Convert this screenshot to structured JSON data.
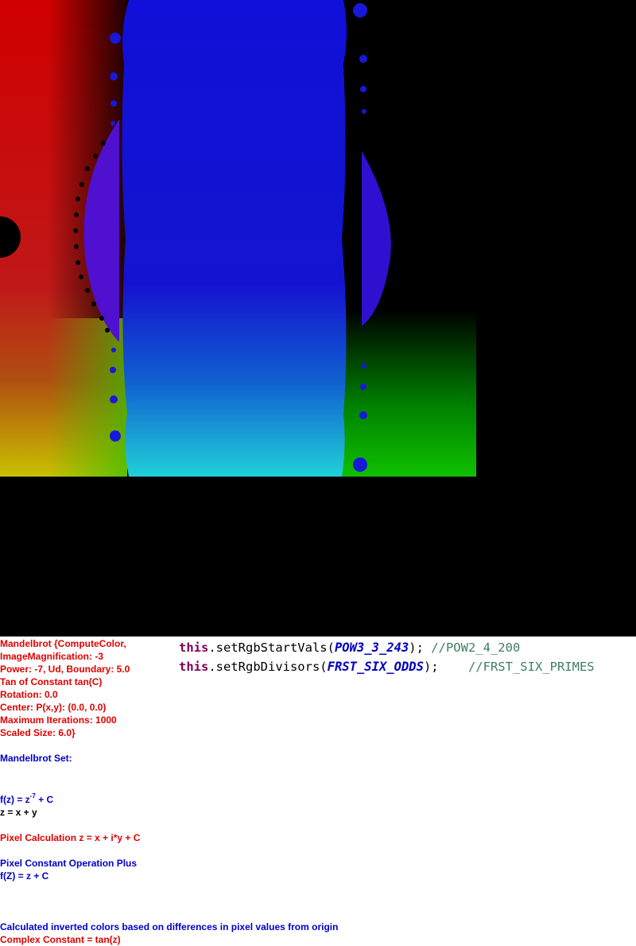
{
  "info": {
    "line1": "Mandelbrot {ComputeColor,",
    "line2": "ImageMagnification: -3",
    "line3": "Power: -7, Ud, Boundary: 5.0",
    "line4": "Tan of Constant tan(C)",
    "line5": "Rotation: 0.0",
    "line6": "Center: P(x,y): (0.0, 0.0)",
    "line7": "Maximum Iterations: 1000",
    "line8": "Scaled Size: 6.0}",
    "set_title": "Mandelbrot Set:",
    "fz_prefix": "f(z) = z",
    "fz_exp": "-7",
    "fz_suffix": " + C",
    "z_def": "z = x + y",
    "pixel_calc": "Pixel Calculation z = x + i*y + C",
    "pixel_const_op": "Pixel Constant Operation Plus",
    "fZ": "f(Z) = z + C",
    "inverted_colors": "Calculated inverted colors based on differences in pixel values from origin",
    "complex_const": "Complex Constant = tan(z)"
  },
  "code": {
    "line1_kw": "this",
    "line1_method": ".setRgbStartVals(",
    "line1_const": "POW3_3_243",
    "line1_end": ");",
    "line1_comment": " //POW2_4_200",
    "line2_kw": "this",
    "line2_method": ".setRgbDivisors(",
    "line2_const": "FRST_SIX_ODDS",
    "line2_end": ");",
    "line2_comment": "    //FRST_SIX_PRIMES"
  }
}
